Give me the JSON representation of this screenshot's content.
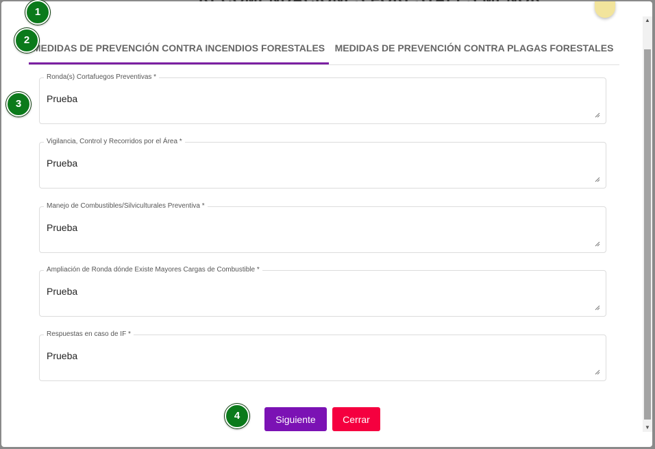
{
  "backdrop": {
    "title": "RECOMENDACIONES FORESTALES MENOR"
  },
  "markers": [
    "1",
    "2",
    "3",
    "4"
  ],
  "tabs": [
    {
      "label": "MEDIDAS DE PREVENCIÓN CONTRA INCENDIOS FORESTALES",
      "active": true
    },
    {
      "label": "MEDIDAS DE PREVENCIÓN CONTRA PLAGAS FORESTALES",
      "active": false
    }
  ],
  "fields": [
    {
      "label": "Ronda(s) Cortafuegos Preventivas *",
      "value": "Prueba"
    },
    {
      "label": "Vigilancia, Control y Recorridos por el Área *",
      "value": "Prueba"
    },
    {
      "label": "Manejo de Combustibles/Silviculturales Preventiva *",
      "value": "Prueba"
    },
    {
      "label": "Ampliación de Ronda dónde Existe Mayores Cargas de Combustible *",
      "value": "Prueba"
    },
    {
      "label": "Respuestas en caso de IF *",
      "value": "Prueba"
    }
  ],
  "buttons": {
    "next": "Siguiente",
    "close": "Cerrar"
  },
  "colors": {
    "accent": "#7b12b4",
    "danger": "#f5003f",
    "marker": "#0b7a1b"
  }
}
